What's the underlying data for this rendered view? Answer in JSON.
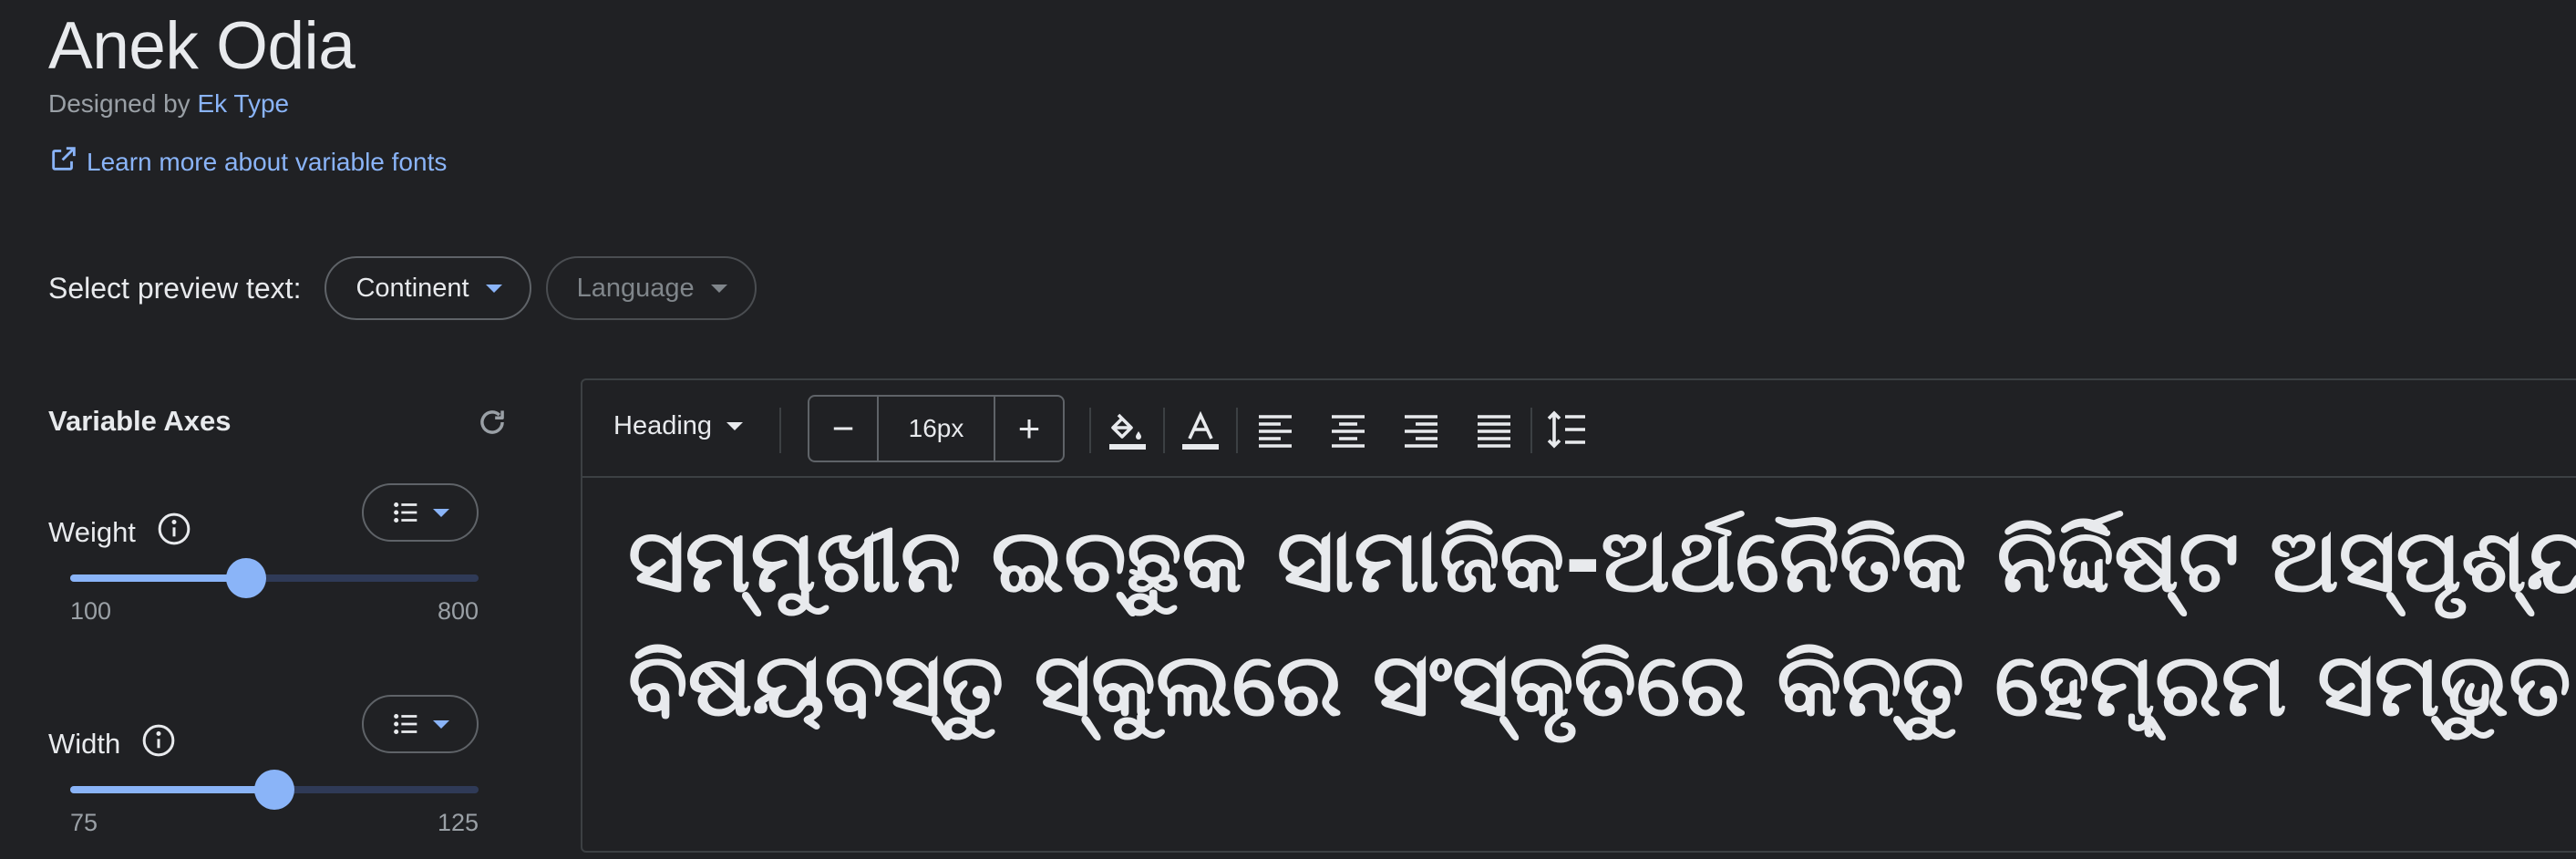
{
  "font": {
    "name": "Anek Odia",
    "designed_by_prefix": "Designed by",
    "designer": "Ek Type",
    "learn_more": "Learn more about variable fonts"
  },
  "preview_selector": {
    "label": "Select preview text:",
    "continent": "Continent",
    "language": "Language"
  },
  "variable_axes": {
    "title": "Variable Axes",
    "axes": [
      {
        "label": "Weight",
        "min": "100",
        "max": "800",
        "value_fraction": 0.43
      },
      {
        "label": "Width",
        "min": "75",
        "max": "125",
        "value_fraction": 0.5
      }
    ]
  },
  "toolbar": {
    "style": "Heading",
    "size": "16px",
    "decrement": "−",
    "increment": "+",
    "icons": [
      "fill-color-icon",
      "text-color-icon",
      "align-left-icon",
      "align-center-icon",
      "align-right-icon",
      "align-justify-icon",
      "line-height-icon"
    ]
  },
  "preview": {
    "lines": [
      "ସମ୍ମୁଖୀନ ଇଚ୍ଛୁକ ସାମାଜିକ-ଅର୍ଥନୈତିକ ନିର୍ଦ୍ଦିଷ୍ଟ ଅସ୍ପୃଶ୍ୟ ନାହିଁ",
      "ବିଷୟବସ୍ତୁ ସ୍କୁଲରେ ସଂସ୍କୃତିରେ କିନ୍ତୁ ହେମ୍ବ୍ରମ ସମ୍ଭୁତ ଲର୍ଣ୍ଣିଂ ହିଁ"
    ]
  },
  "colors": {
    "background": "#202124",
    "accent": "#8ab4f8",
    "text": "#e8eaed",
    "muted": "#9aa0a6"
  }
}
